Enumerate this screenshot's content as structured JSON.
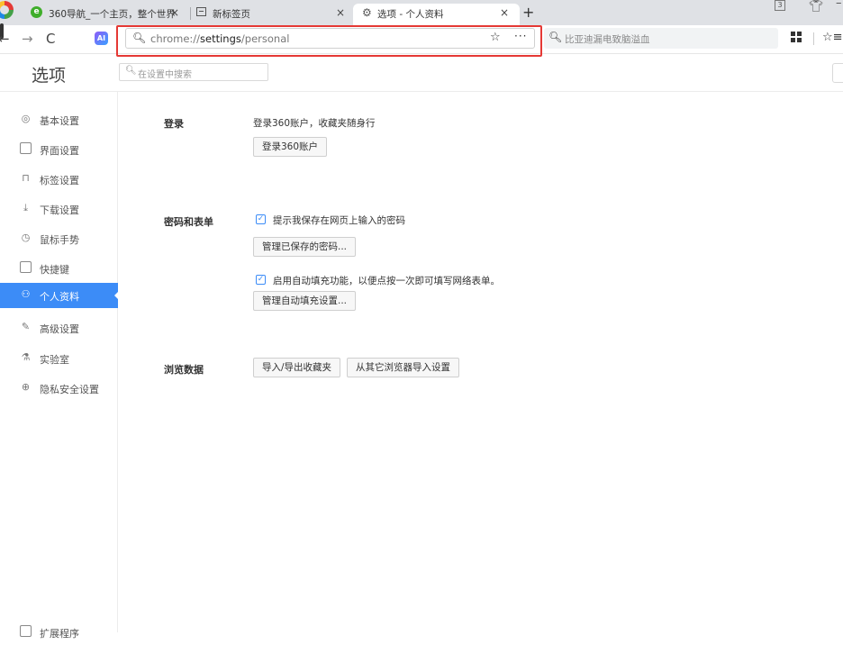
{
  "tabs": [
    {
      "title": "360导航_一个主页，整个世界",
      "close": "×",
      "active": false
    },
    {
      "title": "新标签页",
      "close": "×",
      "active": false
    },
    {
      "title": "选项 - 个人资料",
      "close": "×",
      "active": true
    }
  ],
  "new_tab": "+",
  "window": {
    "badge": "3"
  },
  "toolbar": {
    "ai_label": "AI",
    "address": {
      "prefix": "chrome://",
      "path": "settings",
      "suffix": "/personal"
    },
    "address_more": "···",
    "search_text": "比亚迪漏电致脑溢血"
  },
  "header": {
    "title": "选项",
    "search_placeholder": "在设置中搜索"
  },
  "sidebar": {
    "items": [
      {
        "label": "基本设置",
        "icon": "circle-settings-icon"
      },
      {
        "label": "界面设置",
        "icon": "window-icon"
      },
      {
        "label": "标签设置",
        "icon": "tab-icon"
      },
      {
        "label": "下载设置",
        "icon": "download-icon"
      },
      {
        "label": "鼠标手势",
        "icon": "mouse-icon"
      },
      {
        "label": "快捷键",
        "icon": "keyboard-icon"
      },
      {
        "label": "个人资料",
        "icon": "person-icon",
        "active": true
      },
      {
        "label": "高级设置",
        "icon": "wrench-icon"
      },
      {
        "label": "实验室",
        "icon": "flask-icon"
      },
      {
        "label": "隐私安全设置",
        "icon": "shield-plus-icon"
      }
    ],
    "bottom_item": {
      "label": "扩展程序",
      "icon": "extension-icon"
    }
  },
  "sections": {
    "login": {
      "label": "登录",
      "description": "登录360账户，收藏夹随身行",
      "button": "登录360账户"
    },
    "passwords": {
      "label": "密码和表单",
      "offer_save_label": "提示我保存在网页上输入的密码",
      "offer_save_checked": true,
      "manage_passwords_button": "管理已保存的密码...",
      "autofill_label": "启用自动填充功能，以便点按一次即可填写网络表单。",
      "autofill_checked": true,
      "autofill_settings_button": "管理自动填充设置..."
    },
    "browsing_data": {
      "label": "浏览数据",
      "import_export_button": "导入/导出收藏夹",
      "import_other_button": "从其它浏览器导入设置"
    }
  },
  "colors": {
    "accent": "#3c8cf7",
    "highlight_border": "#e53935"
  }
}
